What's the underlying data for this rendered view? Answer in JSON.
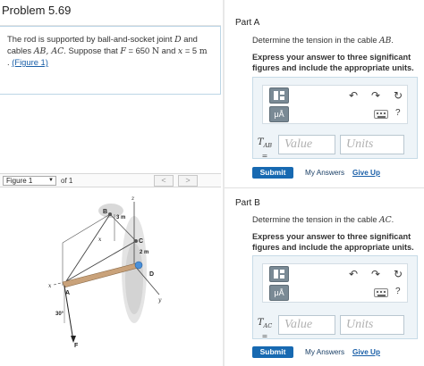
{
  "problem": {
    "title": "Problem 5.69",
    "desc_line1": "The rod is supported by ball-and-socket joint",
    "desc_joint": "D",
    "desc_and": "and",
    "desc_line2_a": "cables",
    "desc_cables": "AB, AC",
    "desc_line2_b": ". Suppose that",
    "desc_F": "F",
    "desc_F_value": "= 650",
    "desc_F_unit": "N",
    "desc_and2": "and",
    "desc_x": "x",
    "desc_x_value": "= 5",
    "desc_x_unit": "m",
    "desc_line3_pre": ".",
    "figure_link": "(Figure 1)"
  },
  "figure_nav": {
    "selected": "Figure 1",
    "of_label": "of 1",
    "prev": "<",
    "next": ">"
  },
  "figure": {
    "label_B": "B",
    "label_3m": "3 m",
    "label_z": "z",
    "label_x_dim": "x",
    "label_C": "C",
    "label_2m": "2 m",
    "label_D": "D",
    "label_x_axis": "x",
    "label_A": "A",
    "label_y": "y",
    "label_30": "30°",
    "label_F": "F"
  },
  "partA": {
    "title": "Part A",
    "question_pre": "Determine the tension in the cable",
    "question_var": "AB",
    "question_post": ".",
    "instructions": "Express your answer to three significant figures and include the appropriate units.",
    "eq_var": "T",
    "eq_sub": "AB",
    "eq_sign": "=",
    "value_placeholder": "Value",
    "units_placeholder": "Units",
    "ua_label": "μÅ",
    "help": "?",
    "submit": "Submit",
    "my_answers": "My Answers",
    "give_up": "Give Up"
  },
  "partB": {
    "title": "Part B",
    "question_pre": "Determine the tension in the cable",
    "question_var": "AC",
    "question_post": ".",
    "instructions": "Express your answer to three significant figures and include the appropriate units.",
    "eq_var": "T",
    "eq_sub": "AC",
    "eq_sign": "=",
    "value_placeholder": "Value",
    "units_placeholder": "Units",
    "ua_label": "μÅ",
    "help": "?",
    "submit": "Submit",
    "my_answers": "My Answers",
    "give_up": "Give Up"
  },
  "toolbar_icons": {
    "undo": "↶",
    "redo": "↷",
    "reset": "↻"
  },
  "colors": {
    "submit_bg": "#1769b1",
    "link": "#1a5fa8",
    "rod": "#c9a27a"
  }
}
